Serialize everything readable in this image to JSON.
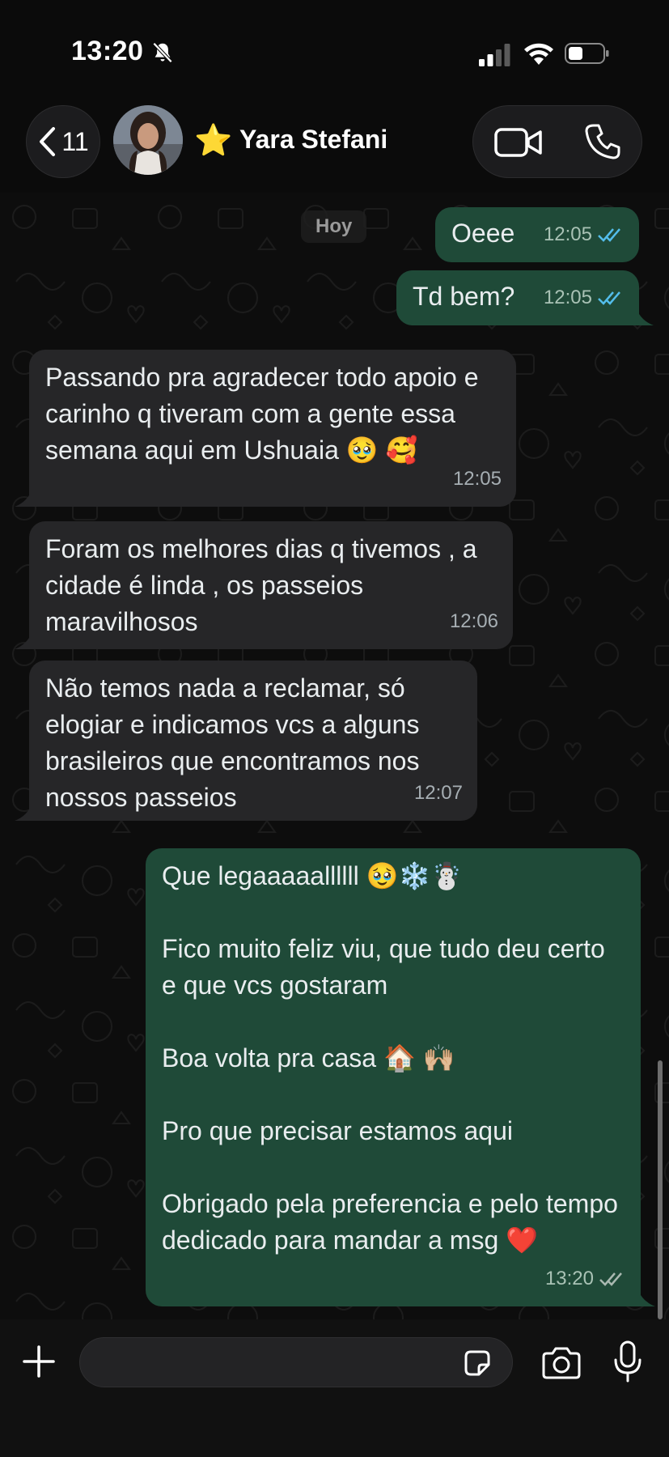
{
  "status_bar": {
    "time": "13:20",
    "icons": [
      "bell-slash-icon",
      "signal-icon",
      "wifi-icon",
      "battery-icon"
    ]
  },
  "header": {
    "back_count": "11",
    "contact_name": "Yara Stefani",
    "star": "⭐",
    "icons": [
      "chevron-left-icon",
      "video-call-icon",
      "phone-icon"
    ]
  },
  "chat": {
    "date_label": "Hoy",
    "messages": [
      {
        "dir": "out",
        "text": "Oeee",
        "time": "12:05",
        "status": "read"
      },
      {
        "dir": "out",
        "text": "Td bem?",
        "time": "12:05",
        "status": "read"
      },
      {
        "dir": "in",
        "text": "Passando pra agradecer todo apoio e carinho q tiveram com a gente essa semana aqui em Ushuaia 🥹 🥰",
        "time": "12:05"
      },
      {
        "dir": "in",
        "text": "Foram os melhores dias q tivemos , a cidade é linda , os passeios maravilhosos",
        "time": "12:06"
      },
      {
        "dir": "in",
        "text": "Não temos nada a reclamar, só elogiar e indicamos vcs a alguns brasileiros que encontramos nos nossos passeios",
        "time": "12:07"
      },
      {
        "dir": "out",
        "lines": [
          "Que legaaaaallllll 🥹❄️☃️",
          "",
          "Fico muito feliz viu, que tudo deu certo e que vcs gostaram",
          "",
          "Boa volta pra casa 🏠 🙌🏼",
          "",
          "Pro que precisar estamos aqui",
          "",
          "Obrigado pela preferencia e pelo tempo dedicado para mandar a msg ❤️"
        ],
        "time": "13:20",
        "status": "delivered"
      }
    ]
  },
  "input_bar": {
    "placeholder": "",
    "icons": [
      "plus-icon",
      "sticker-icon",
      "camera-icon",
      "microphone-icon"
    ]
  },
  "colors": {
    "background": "#0b0b0b",
    "incoming_bubble": "#262628",
    "outgoing_bubble": "#1f4a38",
    "read_ticks": "#53bdeb"
  }
}
